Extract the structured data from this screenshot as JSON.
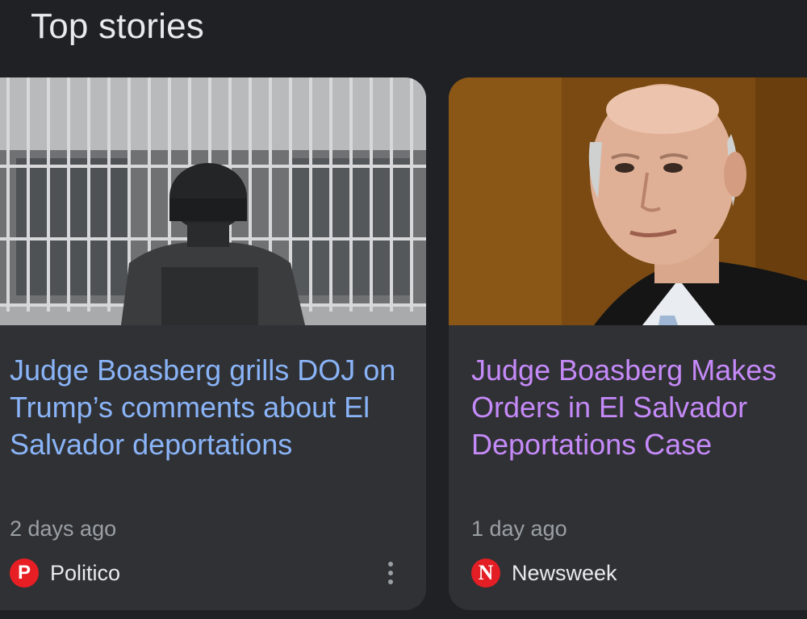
{
  "section": {
    "title": "Top stories"
  },
  "stories": [
    {
      "headline": "Judge Boasberg grills DOJ on Trump’s comments about El Salvador deportations",
      "time": "2 days ago",
      "source": "Politico",
      "favicon_letter": "P",
      "headline_color": "#8ab4f8"
    },
    {
      "headline": "Judge Boasberg Makes Orders in El Salvador Deportations Case",
      "time": "1 day ago",
      "source": "Newsweek",
      "favicon_letter": "N",
      "headline_color": "#c58af9"
    }
  ],
  "icons": {
    "more": "more-vert-icon"
  }
}
